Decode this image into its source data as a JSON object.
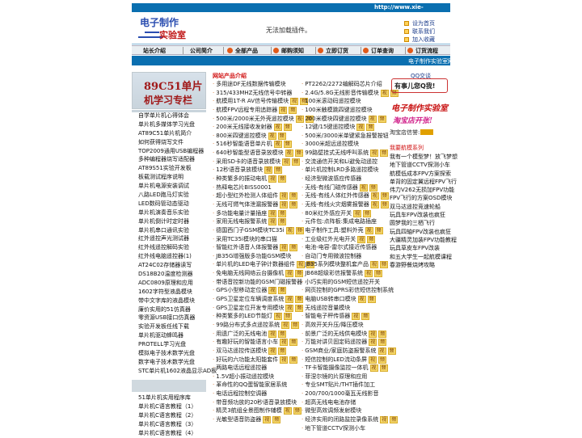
{
  "topbar": {
    "url": "http://www.xie-gang.com"
  },
  "header": {
    "logo_line1": "电子制作",
    "logo_line2": "实验室",
    "plugin_notice": "无法加载插件。",
    "quick_links": [
      "设为首页",
      "联系我们",
      "加入收藏"
    ]
  },
  "nav": {
    "items": [
      "站长介绍",
      "公司简介",
      "全部产品",
      "邮购须知",
      "立即订货",
      "订单查询",
      "订货流程"
    ]
  },
  "marquee": {
    "text": "电子制作实验室网"
  },
  "left": {
    "banner_line1": "89C51单片",
    "banner_line2": "机学习专栏",
    "items": [
      "自学单片机心得体会",
      "单片机多媒体学习光盘",
      "AT89C51单片机简介",
      "如何获得烧写文件",
      "TOP2009通用USB编程器",
      "多种编程器烧写适配器",
      "AT89S51实验开发板",
      "板载测试程序说明",
      "单片机电源安装调试",
      "八路LED跑马灯实验",
      "LED数码管动态驱动",
      "单片机演奏音乐实验",
      "单片机倒计时定时器",
      "单片机串口通讯实验",
      "红外遥控声光测试器",
      "红外线遥控解码实验",
      "红外线电脑遥控器(1)",
      "AT24C02存储器读写",
      "DS18B20温度检测器",
      "ADC0809原理和应用",
      "1602字符型液晶模块",
      "带中文字库的液晶模块",
      "廉价实用的51仿真器",
      "零资源USB接口仿真器",
      "实验开发板任线下载",
      "单片机驱动蜂鸣器",
      "PROTELL学习光盘",
      "模拟电子技术数学光盘",
      "数字电子技术数学光盘",
      "STC单片机1602液晶显示AD板"
    ],
    "items2": [
      "51单片机实用程序库",
      "单片机C语言教程（1）",
      "单片机C语言教程（2）",
      "单片机C语言教程（3）",
      "单片机C语言教程（4）"
    ]
  },
  "middle": {
    "heading": "网站产品介绍",
    "col1": [
      {
        "t": "多用途DF无线数据传输模块",
        "g": false
      },
      {
        "t": "315/433MHZ无线信号中转器",
        "g": false
      },
      {
        "t": "航模用1T-R AV信号传输模块",
        "g": true
      },
      {
        "t": "航模FPV远程专用追踪器",
        "g": true
      },
      {
        "t": "500米/2000米无外壳遥控模块",
        "g": true
      },
      {
        "t": "200米无线接收发射器",
        "g": true
      },
      {
        "t": "800米四键遥控模块",
        "g": true
      },
      {
        "t": "516秒智能语音单片机",
        "g": true
      },
      {
        "t": "640秒智能型语音录放模块",
        "g": true
      },
      {
        "t": "采用SD卡的语音录放模块",
        "g": true
      },
      {
        "t": "12秒语音录放模块",
        "g": true
      },
      {
        "t": "种类繁多的振动电机",
        "g": true
      },
      {
        "t": "热释电芯片BISS0001",
        "g": false
      },
      {
        "t": "超小型红外检测人体组件",
        "g": true
      },
      {
        "t": "无线可燃气体泄漏报警器",
        "g": true
      },
      {
        "t": "多功能电量计量插座",
        "g": true
      },
      {
        "t": "家用无线电报警系统",
        "g": true
      },
      {
        "t": "德国西门子GSM模块TC35i",
        "g": true
      },
      {
        "t": "采用TC35i模块的串口猫",
        "g": false
      },
      {
        "t": "智能红外语音人体报警器",
        "g": true
      },
      {
        "t": "JB35G增强版多功能GSM模块",
        "g": false
      },
      {
        "t": "单片机的LED电子钟计数器组件",
        "g": true
      },
      {
        "t": "免电脑无线网络云台摄像机",
        "g": true
      },
      {
        "t": "带语音控新功能的GSM门磁报警器",
        "g": false
      },
      {
        "t": "GPS小型移动定位器",
        "g": true
      },
      {
        "t": "GPS卫星定位车辆调度系统",
        "g": true
      },
      {
        "t": "GPS卫星定位开发专用模块",
        "g": true
      },
      {
        "t": "种类繁多的LED节能灯",
        "g": true
      },
      {
        "t": "99路分布式多点遥控系统",
        "g": true
      },
      {
        "t": "用遗广泛的无线电池",
        "g": true
      },
      {
        "t": "有趣好玩的智能语言小车",
        "g": true
      },
      {
        "t": "双马达遥控传送模块",
        "g": true
      },
      {
        "t": "好玩的六功能太阳能套件",
        "g": true
      },
      {
        "t": "两路电话远程遥控器",
        "g": false
      },
      {
        "t": "1.5V超小振动遥控模块",
        "g": false
      },
      {
        "t": "革命性的QQ蛋智能家居系统",
        "g": false
      },
      {
        "t": "电话远程控制空调器",
        "g": false
      },
      {
        "t": "带音频功放的20秒语音录放模块",
        "g": false
      },
      {
        "t": "精灵3航组全景图制作辅模",
        "g": true
      },
      {
        "t": "光敏型语音防盗器",
        "g": true
      }
    ],
    "col2": [
      {
        "t": "PT2262/2272编解码芯片介绍",
        "g": false
      },
      {
        "t": "2.4G/5.8G无线影音传输模块",
        "g": true
      },
      {
        "t": "100米滚动码遥控模块",
        "g": false
      },
      {
        "t": "100米触模跳四键遥控模块",
        "g": false
      },
      {
        "t": "200米模块四键遥控模块",
        "g": true
      },
      {
        "t": "12键/15键遥控模块",
        "g": true
      },
      {
        "t": "500米/3000米单键紧急报警按钮",
        "g": false
      },
      {
        "t": "3000米超远遥控模块",
        "g": false
      },
      {
        "t": "99路壁挂式无线呼叫系统",
        "g": true
      },
      {
        "t": "交流通信开关和Li避免动遥控",
        "g": false
      },
      {
        "t": "单片机控制LRD多路遥控模块",
        "g": false
      },
      {
        "t": "经济型微波感应传感器",
        "g": false
      },
      {
        "t": "无线-有线门磁传感器",
        "g": true
      },
      {
        "t": "无线-有线人体红外传感器",
        "g": true
      },
      {
        "t": "无线-有线火灾烟雾报警器",
        "g": true
      },
      {
        "t": "80米红外感应开关",
        "g": true
      },
      {
        "t": "元件包:点阵板:集成电路插座",
        "g": false
      },
      {
        "t": "电子制作工具:塑料外壳",
        "g": true
      },
      {
        "t": "工业级红外光电开关",
        "g": true
      },
      {
        "t": "电池-电容-雷尔式接近传感器",
        "g": false
      },
      {
        "t": "自动门专用微波控制器",
        "g": false
      },
      {
        "t": "JB35系列模块整机套产品",
        "g": true
      },
      {
        "t": "JB68超级彩信报警系统",
        "g": true
      },
      {
        "t": "小巧实用的GSM短信遥控开关",
        "g": false
      },
      {
        "t": "网页控制的GPRS彩信短信控制系统",
        "g": false
      },
      {
        "t": "电脑USB转串口模块",
        "g": true
      },
      {
        "t": "无线遥控音量模块",
        "g": false
      },
      {
        "t": "智能电子秤传感器",
        "g": true
      },
      {
        "t": "高效开关升压/降压模块",
        "g": false
      },
      {
        "t": "前景广泛的无线供电模块",
        "g": true
      },
      {
        "t": "万能对讲贝固定码遥控器",
        "g": true
      },
      {
        "t": "GSM商业/家庭防盗报警系统",
        "g": true
      },
      {
        "t": "短信控制的LED流动条屏",
        "g": true
      },
      {
        "t": "TF卡智能摄像监控一体机",
        "g": true
      },
      {
        "t": "菲涅尔镜的片原理和应用",
        "g": false
      },
      {
        "t": "专业SMT贴片/THT插件加工",
        "g": false
      },
      {
        "t": "200/700/1000毫瓦无线影音",
        "g": false
      },
      {
        "t": "超高无线电电池存储",
        "g": false
      },
      {
        "t": "微型高效调频发射模块",
        "g": false
      },
      {
        "t": "经济实用的闭路监控录像系统",
        "g": true
      },
      {
        "t": "地下管道CCTV探测小车",
        "g": false
      }
    ]
  },
  "right": {
    "qq_title": "QQ交谈",
    "qq_button": "有事儿您Q我!",
    "promo1": "电子制作实验室",
    "promo2": "淘宝店开张!",
    "taobao_label": "淘宝店信誉:",
    "new_title": "我要航模系列",
    "items": [
      "我有一个模型梦！放飞梦想",
      "地下管道CCTV探测小车",
      "航模低成本FPV方案探索",
      "单背的固定翼远程FPV飞行",
      "伟力V262无损加FPV功能",
      "FPV飞行的方案OSD模块",
      "双马达遥控竞速轮船",
      "玩具车FPV改装也疯狂",
      "圆梦我的三栖飞行",
      "玩具四轴FPV改装也疯狂",
      "大疆精灵加装FPV功能教程",
      "玩具草皮车FPV改装",
      "和五大学生一起航模课程",
      "春游野餐烧烤攻略"
    ]
  }
}
